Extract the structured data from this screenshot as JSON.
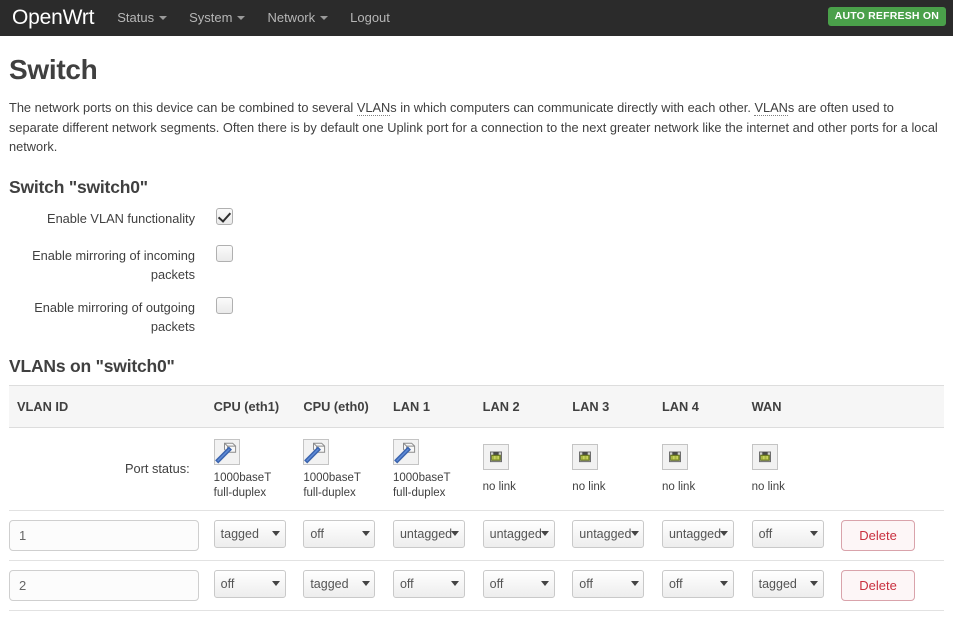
{
  "header": {
    "brand": "OpenWrt",
    "nav": [
      {
        "label": "Status",
        "has_caret": true
      },
      {
        "label": "System",
        "has_caret": true
      },
      {
        "label": "Network",
        "has_caret": true
      },
      {
        "label": "Logout",
        "has_caret": false
      }
    ],
    "refresh_badge": "AUTO REFRESH ON",
    "refresh_badge_color": "#4aa04a"
  },
  "page": {
    "title": "Switch",
    "description_part1": "The network ports on this device can be combined to several ",
    "abbr1": "VLAN",
    "description_part2": "s in which computers can communicate directly with each other. ",
    "abbr2": "VLAN",
    "description_part3": "s are often used to separate different network segments. Often there is by default one Uplink port for a connection to the next greater network like the internet and other ports for a local network."
  },
  "switch_section": {
    "title": "Switch \"switch0\"",
    "fields": [
      {
        "label": "Enable VLAN functionality",
        "checked": true,
        "name": "enable-vlan"
      },
      {
        "label": "Enable mirroring of incoming packets",
        "checked": false,
        "name": "mirror-incoming"
      },
      {
        "label": "Enable mirroring of outgoing packets",
        "checked": false,
        "name": "mirror-outgoing"
      }
    ]
  },
  "vlan_section": {
    "title": "VLANs on \"switch0\"",
    "columns": [
      "VLAN ID",
      "CPU (eth1)",
      "CPU (eth0)",
      "LAN 1",
      "LAN 2",
      "LAN 3",
      "LAN 4",
      "WAN",
      ""
    ],
    "port_status_label": "Port status:",
    "port_status": [
      {
        "port": "CPU (eth1)",
        "icon": "ethernet-plug-connected-icon",
        "line1": "1000baseT",
        "line2": "full-duplex",
        "linked": true
      },
      {
        "port": "CPU (eth0)",
        "icon": "ethernet-plug-connected-icon",
        "line1": "1000baseT",
        "line2": "full-duplex",
        "linked": true
      },
      {
        "port": "LAN 1",
        "icon": "ethernet-plug-connected-icon",
        "line1": "1000baseT",
        "line2": "full-duplex",
        "linked": true
      },
      {
        "port": "LAN 2",
        "icon": "ethernet-jack-nolink-icon",
        "line1": "no link",
        "line2": "",
        "linked": false
      },
      {
        "port": "LAN 3",
        "icon": "ethernet-jack-nolink-icon",
        "line1": "no link",
        "line2": "",
        "linked": false
      },
      {
        "port": "LAN 4",
        "icon": "ethernet-jack-nolink-icon",
        "line1": "no link",
        "line2": "",
        "linked": false
      },
      {
        "port": "WAN",
        "icon": "ethernet-jack-nolink-icon",
        "line1": "no link",
        "line2": "",
        "linked": false
      }
    ],
    "rows": [
      {
        "vlan_id": "1",
        "ports": [
          "tagged",
          "off",
          "untagged",
          "untagged",
          "untagged",
          "untagged",
          "off"
        ],
        "delete_label": "Delete"
      },
      {
        "vlan_id": "2",
        "ports": [
          "off",
          "tagged",
          "off",
          "off",
          "off",
          "off",
          "tagged"
        ],
        "delete_label": "Delete"
      }
    ],
    "select_options": [
      "untagged",
      "tagged",
      "off"
    ]
  }
}
